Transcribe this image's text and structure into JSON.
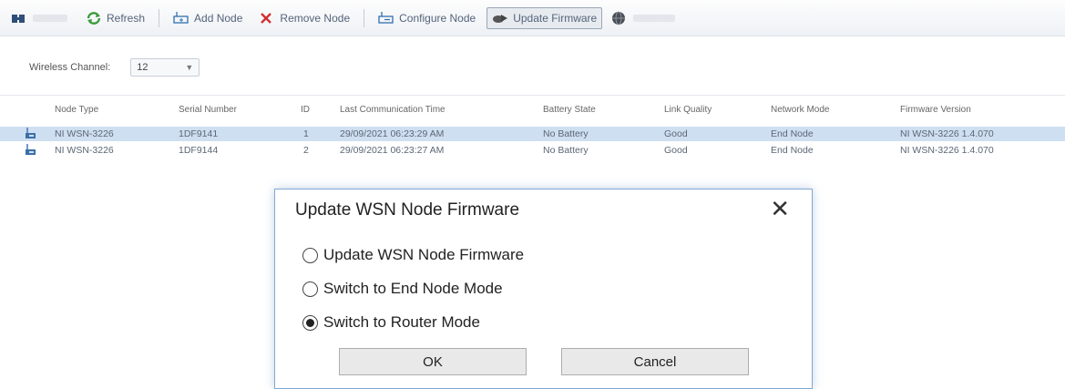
{
  "toolbar": {
    "buttons": [
      {
        "label": "Refresh",
        "icon": "refresh-icon",
        "color": "#3a9a3a"
      },
      {
        "label": "Add Node",
        "icon": "add-node-icon",
        "color": "#2f6fb0"
      },
      {
        "label": "Remove Node",
        "icon": "remove-node-icon",
        "color": "#d03030"
      },
      {
        "label": "Configure Node",
        "icon": "configure-node-icon",
        "color": "#2f6fb0"
      },
      {
        "label": "Update Firmware",
        "icon": "update-firmware-icon",
        "color": "#555555"
      }
    ]
  },
  "channel": {
    "label": "Wireless Channel:",
    "value": "12"
  },
  "table": {
    "columns": [
      "Node Type",
      "Serial Number",
      "ID",
      "Last Communication Time",
      "Battery State",
      "Link Quality",
      "Network Mode",
      "Firmware Version"
    ],
    "rows": [
      [
        "NI WSN-3226",
        "1DF9141",
        "1",
        "29/09/2021 06:23:29 AM",
        "No Battery",
        "Good",
        "End Node",
        "NI WSN-3226 1.4.070"
      ],
      [
        "NI WSN-3226",
        "1DF9144",
        "2",
        "29/09/2021 06:23:27 AM",
        "No Battery",
        "Good",
        "End Node",
        "NI WSN-3226 1.4.070"
      ]
    ],
    "selected_row": 0
  },
  "dialog": {
    "title": "Update WSN Node Firmware",
    "close": "✕",
    "options": [
      {
        "label": "Update WSN Node Firmware",
        "checked": false
      },
      {
        "label": "Switch to End Node Mode",
        "checked": false
      },
      {
        "label": "Switch to Router Mode",
        "checked": true
      }
    ],
    "ok_label": "OK",
    "cancel_label": "Cancel"
  }
}
